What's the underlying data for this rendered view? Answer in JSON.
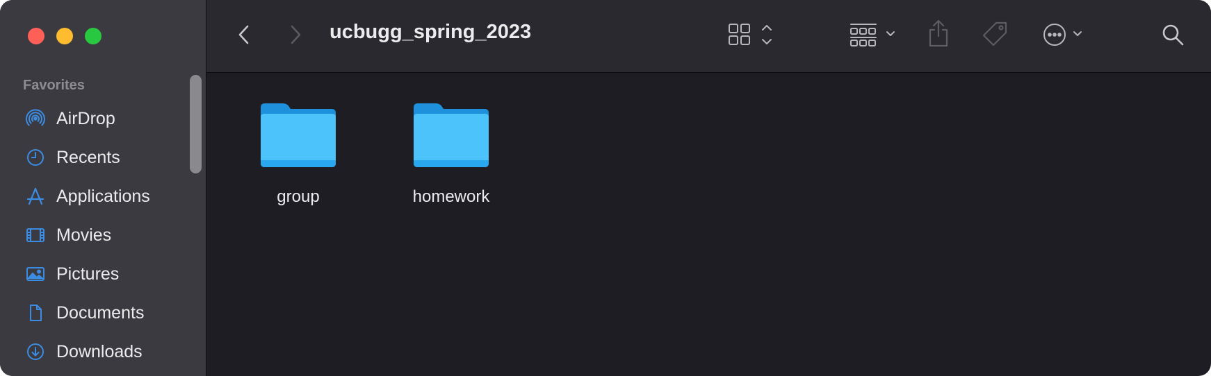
{
  "window": {
    "title": "ucbugg_spring_2023"
  },
  "sidebar": {
    "section_title": "Favorites",
    "items": [
      {
        "label": "AirDrop",
        "icon": "airdrop-icon"
      },
      {
        "label": "Recents",
        "icon": "clock-icon"
      },
      {
        "label": "Applications",
        "icon": "applications-icon"
      },
      {
        "label": "Movies",
        "icon": "film-icon"
      },
      {
        "label": "Pictures",
        "icon": "photo-icon"
      },
      {
        "label": "Documents",
        "icon": "document-icon"
      },
      {
        "label": "Downloads",
        "icon": "download-icon"
      }
    ]
  },
  "toolbar": {
    "back": "chevron-left-icon",
    "forward": "chevron-right-icon",
    "view_mode": "grid-view-icon",
    "group_by": "group-by-icon",
    "share": "share-icon",
    "tags": "tag-icon",
    "more_actions": "ellipsis-circle-icon",
    "search": "search-icon"
  },
  "files": [
    {
      "name": "group",
      "type": "folder"
    },
    {
      "name": "homework",
      "type": "folder"
    }
  ],
  "colors": {
    "accent": "#3b8de4",
    "folder": "#4cc3fb",
    "sidebar_bg": "#3b3a40",
    "content_bg": "#1e1d24"
  }
}
